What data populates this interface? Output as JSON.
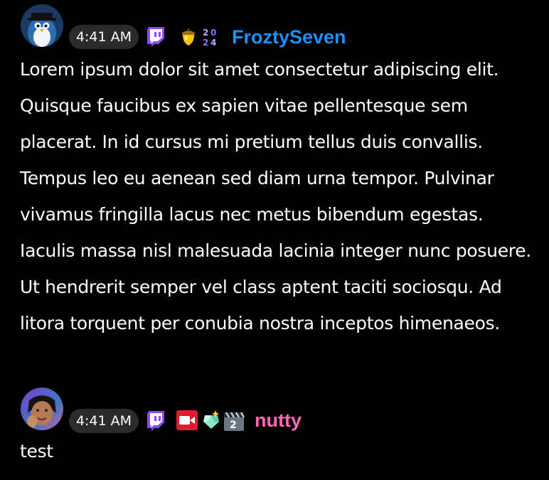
{
  "chat": {
    "messages": [
      {
        "time": "4:41 AM",
        "username": "FroztySeven",
        "username_color": "#1e90ff",
        "avatar": "penguin-avatar",
        "badges": [
          "twitch-icon",
          "acorn-badge-icon",
          "year-2024-badge-icon"
        ],
        "text": "Lorem ipsum dolor sit amet consectetur adipiscing elit. Quisque faucibus ex sapien vitae pellentesque sem placerat. In id cursus mi pretium tellus duis convallis. Tempus leo eu aenean sed diam urna tempor. Pulvinar vivamus fringilla lacus nec metus bibendum egestas. Iaculis massa nisl malesuada lacinia integer nunc posuere. Ut hendrerit semper vel class aptent taciti sociosqu. Ad litora torquent per conubia nostra inceptos himenaeos."
      },
      {
        "time": "4:41 AM",
        "username": "nutty",
        "username_color": "#ff69b4",
        "avatar": "user-photo-avatar",
        "badges": [
          "twitch-icon",
          "video-camera-icon",
          "gem-badge-icon",
          "clapperboard-2-icon"
        ],
        "text": "test"
      }
    ]
  },
  "colors": {
    "background": "#000000",
    "time_pill": "#2b2b2e",
    "twitch_purple": "#9146ff"
  }
}
